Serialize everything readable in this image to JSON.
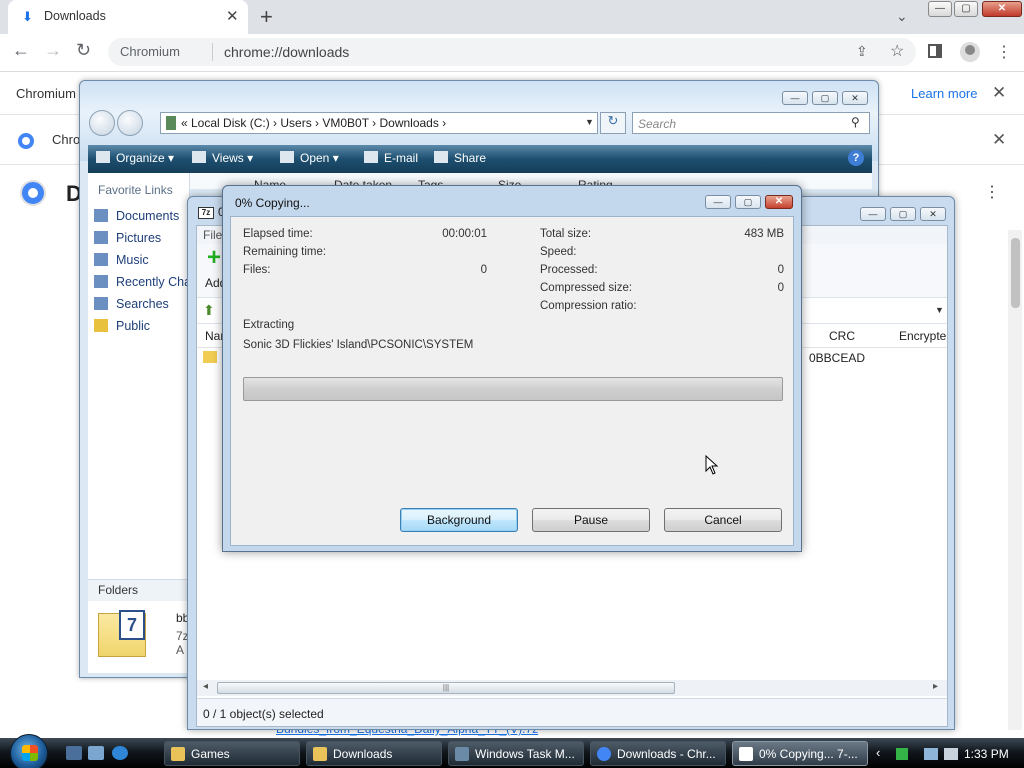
{
  "browser": {
    "tab_title": "Downloads",
    "tab_close": "✕",
    "new_tab": "+",
    "tabs_menu": "⌄",
    "window": {
      "min": "—",
      "max": "▢",
      "close": "✕"
    },
    "nav": {
      "back": "←",
      "forward": "→",
      "reload": "↻"
    },
    "omnibox": {
      "site_label": "Chromium",
      "url": "chrome://downloads",
      "share": "⇪",
      "star": "☆"
    },
    "menu": "⋮",
    "infobar1": {
      "text": "Chromium",
      "link": "Learn more",
      "close": "✕"
    },
    "infobar2": {
      "text": "Chro",
      "close": "✕"
    },
    "page_title": "D",
    "page_menu": "⋮",
    "bottom_link": "Bundles_from_Equestria_Daily_Alpha_TT_(V).7z"
  },
  "explorer": {
    "window": {
      "min": "—",
      "max": "▢",
      "close": "✕"
    },
    "address_crumbs": "«  Local Disk (C:)  ›  Users  ›  VM0B0T  ›  Downloads  ›",
    "address_dropdown": "▼",
    "refresh": "↻",
    "search_placeholder": "Search",
    "search_icon": "⚲",
    "commands": [
      {
        "label": "Organize  ▾"
      },
      {
        "label": "Views  ▾"
      },
      {
        "label": "Open  ▾"
      },
      {
        "label": "E-mail"
      },
      {
        "label": "Share"
      }
    ],
    "help": "?",
    "favorite_links_header": "Favorite Links",
    "favorite_links": [
      "Documents",
      "Pictures",
      "Music",
      "Recently Cha",
      "Searches",
      "Public"
    ],
    "folders_label": "Folders",
    "details_icon_text": "7",
    "details_name": "bbi",
    "details_type": "7z A",
    "columns": [
      "Name",
      "Date taken",
      "Tags",
      "Size",
      "Rating"
    ]
  },
  "sevenzip": {
    "title_icon": "7z",
    "title": "0",
    "window": {
      "min": "—",
      "max": "▢",
      "close": "✕"
    },
    "menu_file": "File",
    "toolbar_add_label": "Add",
    "toolbar_add_icon": "+",
    "up_icon": "⬆",
    "address_dropdown": "▼",
    "columns": {
      "name": "Nar",
      "crc": "CRC",
      "encrypted": "Encrypte"
    },
    "row": {
      "crc": "0BBCEAD"
    },
    "hscroll": {
      "left": "◂",
      "right": "▸",
      "grip": "|||"
    },
    "status": "0 / 1 object(s) selected"
  },
  "dialog": {
    "title": "0% Copying...",
    "window": {
      "min": "—",
      "max": "▢",
      "close": "✕"
    },
    "left_stats": [
      {
        "label": "Elapsed time:",
        "value": "00:00:01"
      },
      {
        "label": "Remaining time:",
        "value": ""
      },
      {
        "label": "Files:",
        "value": "0"
      }
    ],
    "right_stats": [
      {
        "label": "Total size:",
        "value": "483 MB"
      },
      {
        "label": "Speed:",
        "value": ""
      },
      {
        "label": "Processed:",
        "value": "0"
      },
      {
        "label": "Compressed size:",
        "value": "0"
      },
      {
        "label": "Compression ratio:",
        "value": ""
      }
    ],
    "operation": "Extracting",
    "current_file": "Sonic 3D Flickies' Island\\PCSONIC\\SYSTEM",
    "progress_percent": 0,
    "buttons": {
      "background": "Background",
      "pause": "Pause",
      "cancel": "Cancel"
    }
  },
  "taskbar": {
    "tasks": [
      {
        "label": "Games"
      },
      {
        "label": "Downloads"
      },
      {
        "label": "Windows Task M..."
      },
      {
        "label": "Downloads - Chr..."
      },
      {
        "label": "0% Copying... 7-..."
      }
    ],
    "tray_chevron": "‹",
    "clock": "1:33 PM"
  },
  "colors": {
    "vista_cmdbar": "#1d4f70",
    "chrome_blue": "#1a73e8",
    "dialog_frame": "#c4d8ed"
  }
}
